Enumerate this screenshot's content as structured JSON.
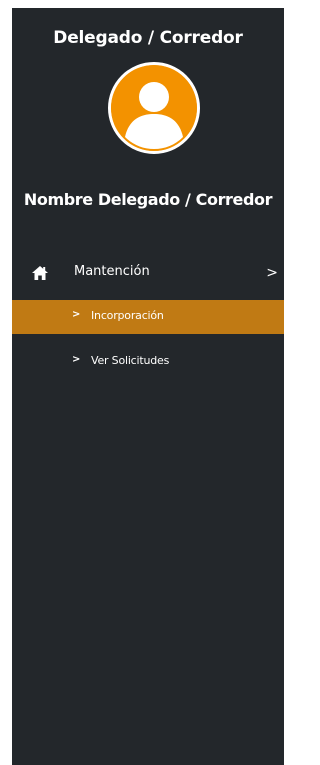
{
  "sidebar": {
    "role_title": "Delegado / Corredor",
    "user_name": "Nombre Delegado / Corredor",
    "avatar_icon": "user-avatar-icon",
    "menu": [
      {
        "label": "Mantención",
        "icon": "home-icon",
        "chevron": ">",
        "children": [
          {
            "label": "Incorporación",
            "chevron": ">",
            "active": true
          },
          {
            "label": "Ver Solicitudes",
            "chevron": ">",
            "active": false
          }
        ]
      }
    ]
  },
  "colors": {
    "sidebar_bg": "#23272b",
    "accent": "#f39200",
    "active_bg": "#c07a14",
    "text": "#ffffff"
  }
}
